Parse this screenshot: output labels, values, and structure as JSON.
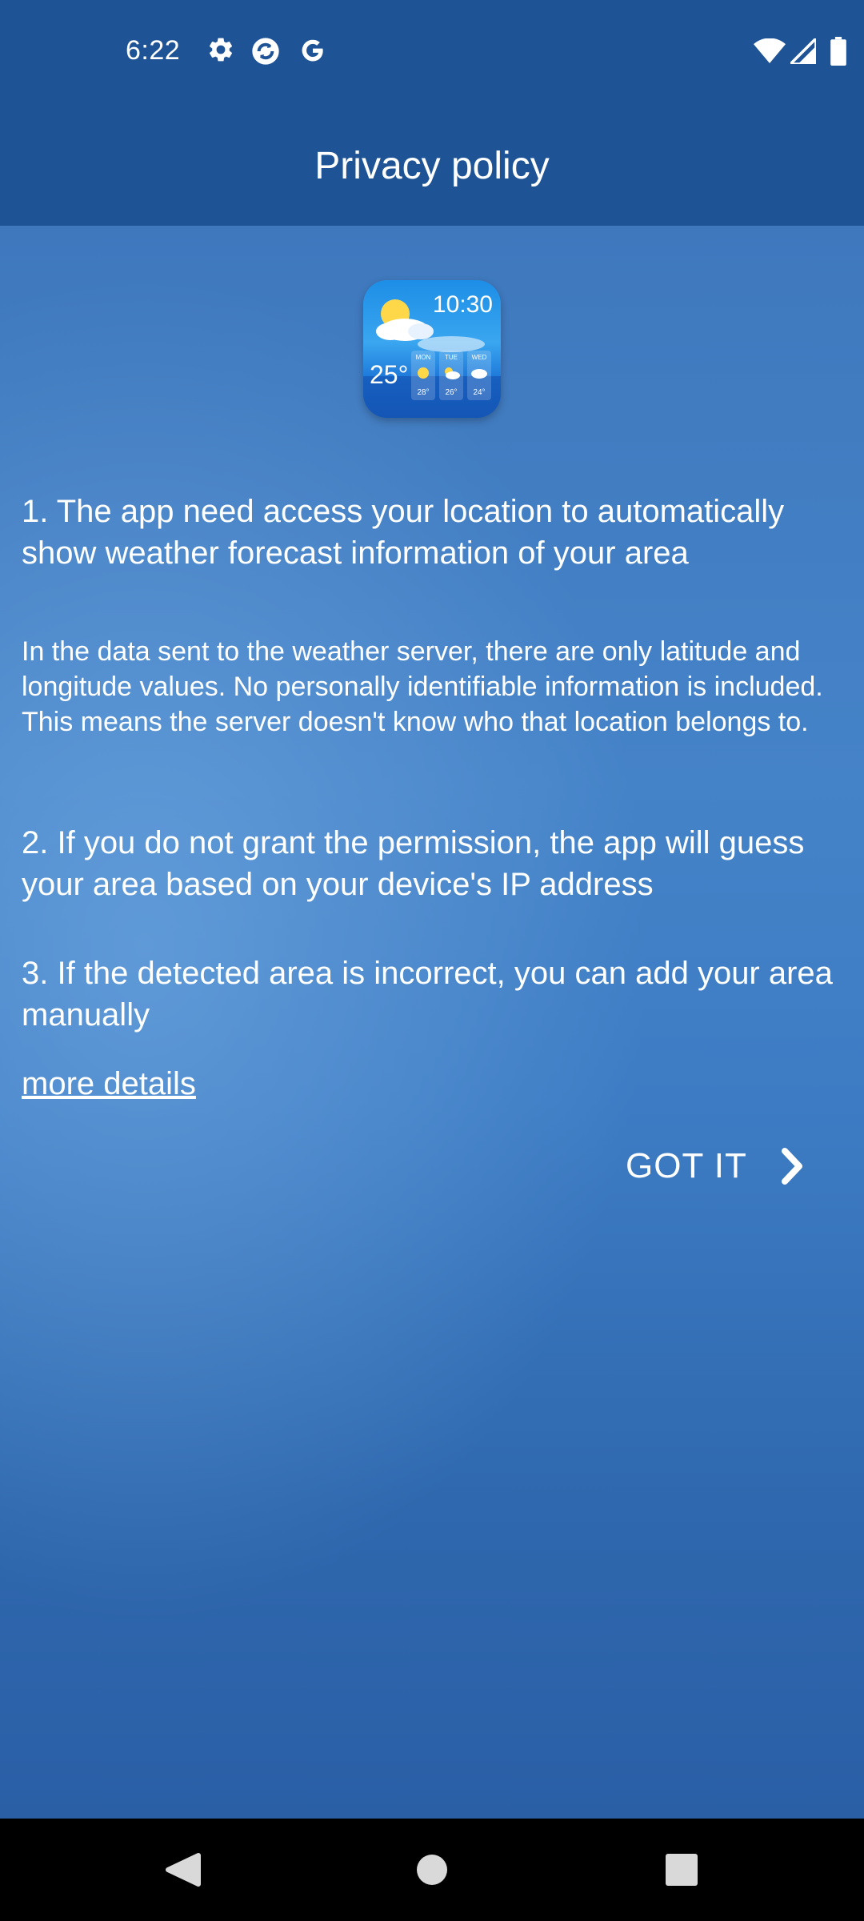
{
  "status_bar": {
    "time": "6:22",
    "left_icons": [
      "gear-icon",
      "sync-app-icon",
      "google-icon"
    ],
    "right_icons": [
      "wifi-icon",
      "signal-icon",
      "battery-icon"
    ]
  },
  "app_bar": {
    "title": "Privacy policy"
  },
  "app_icon": {
    "time": "10:30",
    "temperature": "25°",
    "days": [
      {
        "name": "MON",
        "temp": "28°"
      },
      {
        "name": "TUE",
        "temp": "26°"
      },
      {
        "name": "WED",
        "temp": "24°"
      }
    ]
  },
  "policy": {
    "point1_heading": "1. The app need access your location to automatically show weather forecast information of your area",
    "point1_detail": "In the data sent to the weather server, there are only latitude and longitude values. No personally identifiable information is included. This means the server doesn't know who that location belongs to.",
    "point2": "2. If you do not grant the permission, the app will guess your area based on your device's IP address",
    "point3": "3. If the detected area is incorrect, you can add your area manually",
    "more_details": "more details"
  },
  "actions": {
    "got_it_label": "GOT IT",
    "got_it_icon": "chevron-right-icon"
  },
  "navigation_bar": {
    "buttons": [
      "back-icon",
      "home-icon",
      "recents-icon"
    ]
  },
  "colors": {
    "app_bar": "#1e5396",
    "background": "#3f78bd",
    "text": "#ffffff",
    "nav_bar": "#000000"
  }
}
